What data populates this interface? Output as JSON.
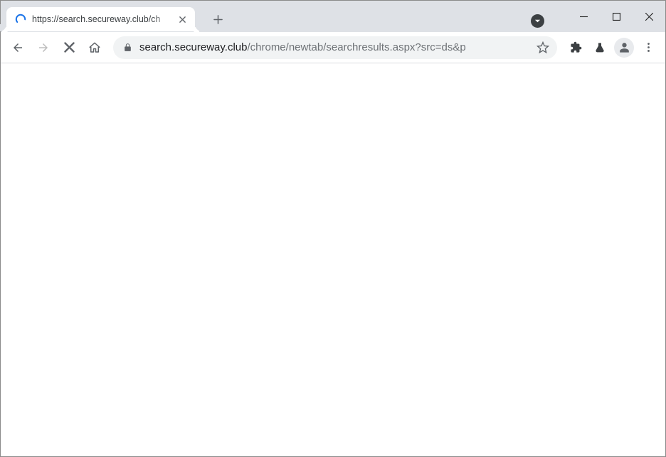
{
  "tab": {
    "title": "https://search.secureway.club/ch"
  },
  "omnibox": {
    "host": "search.secureway.club",
    "path": "/chrome/newtab/searchresults.aspx?src=ds&p"
  }
}
